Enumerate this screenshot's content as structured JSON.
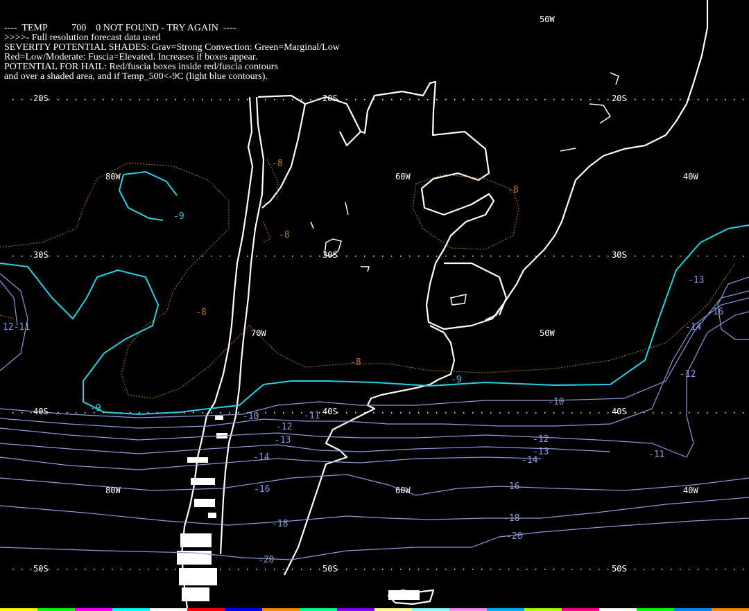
{
  "header": {
    "line1": "----  TEMP          700    0 NOT FOUND - TRY AGAIN  ----",
    "line2": ">>>>- Full resolution forecast data used",
    "line3": "SEVERITY POTENTIAL SHADES: Grav=Strong Convection: Green=Marginal/Low",
    "line4": "Red=Low/Moderate: Fuscia=Elevated. Increases if boxes appear.",
    "line5": "POTENTIAL FOR HAIL: Red/fuscia boxes inside red/fuscia contours",
    "line6": "and over a shaded area, and if Temp_500<-9C (light blue contours)."
  },
  "grid_labels": {
    "lat_20s": "20S",
    "lat_30s": "30S",
    "lat_40s": "40S",
    "lat_50s": "50S",
    "lon_80w": "80W",
    "lon_70w": "70W",
    "lon_60w": "60W",
    "lon_50w": "50W",
    "lon_40w": "40W"
  },
  "contour_labels": {
    "m8": "-8",
    "m9": "-9",
    "m10": "-10",
    "m11": "-11",
    "m12": "-12",
    "m13": "-13",
    "m14": "-14",
    "m16": "-16",
    "m18": "-18",
    "m20": "-20",
    "left_edge": "12-11",
    "right_m13": "-13"
  },
  "colors": {
    "background": "#000000",
    "coastline": "#ffffff",
    "contour_minus9": "#22d3e6",
    "contour_cold": "#8c9ae0",
    "contour_warm": "#c07820",
    "grid_label": "#ffffff"
  },
  "color_strip": [
    "#ffff00",
    "#00ff00",
    "#ff00ff",
    "#00ffff",
    "#ffffff",
    "#ff0000",
    "#0000ff",
    "#ff8800",
    "#00ff88",
    "#8800ff",
    "#ffff88",
    "#88ffff",
    "#ff88ff",
    "#00aaff",
    "#aaff00",
    "#ff0088",
    "#ffffff",
    "#00ff00",
    "#0088ff",
    "#ff8800"
  ]
}
